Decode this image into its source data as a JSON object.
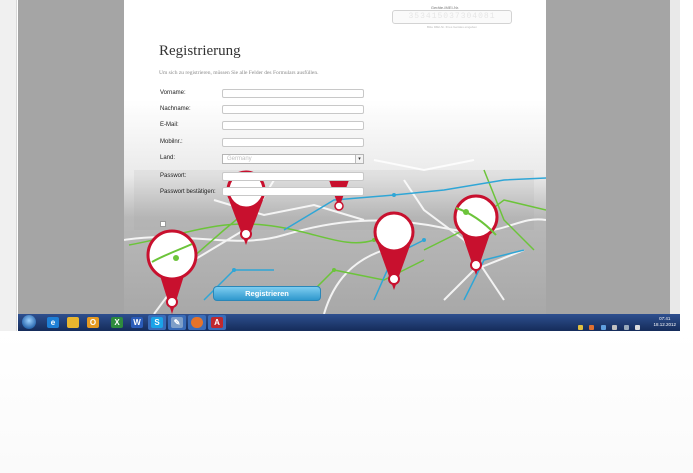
{
  "device_id": {
    "label": "Geräte-IMEI-Nr.",
    "value": "353415037304081",
    "hint": "Bitte IMEI-Nr. Ihres Gerätes eingeben"
  },
  "form": {
    "title": "Registrierung",
    "subtitle": "Um sich zu registrieren, müssen Sie alle Felder des Formulars ausfüllen.",
    "fields": [
      {
        "label": "Vorname:",
        "value": ""
      },
      {
        "label": "Nachname:",
        "value": ""
      },
      {
        "label": "E-Mail:",
        "value": ""
      },
      {
        "label": "Mobilnr.:",
        "value": ""
      },
      {
        "label": "Land:",
        "value": "Germany"
      },
      {
        "label": "Passwort:",
        "value": ""
      },
      {
        "label": "Passwort bestätigen:",
        "value": ""
      }
    ],
    "submit_label": "Registrieren"
  },
  "taskbar": {
    "apps": [
      "ie-icon",
      "explorer-icon",
      "outlook-icon",
      "excel-icon",
      "word-icon",
      "skype-icon",
      "tool-icon",
      "firefox-icon",
      "acrobat-icon"
    ],
    "clock_time": "07:41",
    "clock_date": "18.12.2012"
  },
  "colors": {
    "pin_red": "#c8102e",
    "route_green": "#5fbf2f",
    "route_blue": "#2fa6d6",
    "button_blue": "#2f98cd"
  }
}
